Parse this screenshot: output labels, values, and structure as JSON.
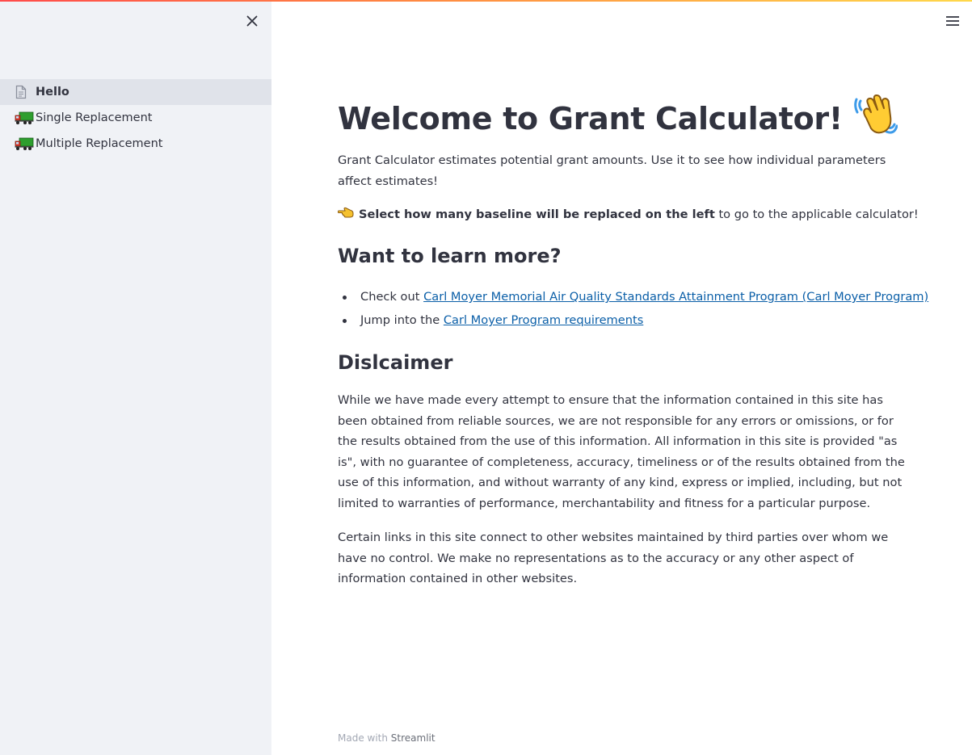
{
  "sidebar": {
    "items": [
      {
        "label": "Hello",
        "icon": "document-icon",
        "active": true
      },
      {
        "label": "Single Replacement",
        "icon": "truck-icon",
        "active": false
      },
      {
        "label": "Multiple Replacement",
        "icon": "truck-icon",
        "active": false
      }
    ]
  },
  "main": {
    "title": "Welcome to Grant Calculator!",
    "intro": "Grant Calculator estimates potential grant amounts. Use it to see how individual parameters affect estimates!",
    "select_bold": "Select how many baseline will be replaced on the left",
    "select_rest": " to go to the applicable calculator!",
    "learn_heading": "Want to learn more?",
    "links": [
      {
        "prefix": "Check out ",
        "text": "Carl Moyer Memorial Air Quality Standards Attainment Program (Carl Moyer Program)"
      },
      {
        "prefix": "Jump into the ",
        "text": "Carl Moyer Program requirements"
      }
    ],
    "disclaimer_heading": "Dislcaimer",
    "disclaimer_1": "While we have made every attempt to ensure that the information contained in this site has been obtained from reliable sources, we are not responsible for any errors or omissions, or for the results obtained from the use of this information. All information in this site is provided \"as is\", with no guarantee of completeness, accuracy, timeliness or of the results obtained from the use of this information, and without warranty of any kind, express or implied, including, but not limited to warranties of performance, merchantability and fitness for a particular purpose.",
    "disclaimer_2": "Certain links in this site connect to other websites maintained by third parties over whom we have no control. We make no representations as to the accuracy or any other aspect of information contained in other websites."
  },
  "footer": {
    "prefix": "Made with ",
    "brand": "Streamlit"
  },
  "colors": {
    "sidebar_bg": "#f0f2f6",
    "link": "#0b5fa8",
    "text": "#31333f",
    "active_item": "#e0e3ea"
  },
  "icons": {
    "close": "close-icon",
    "menu": "hamburger-menu-icon",
    "wave": "waving-hand-icon",
    "point": "pointing-left-hand-icon"
  }
}
